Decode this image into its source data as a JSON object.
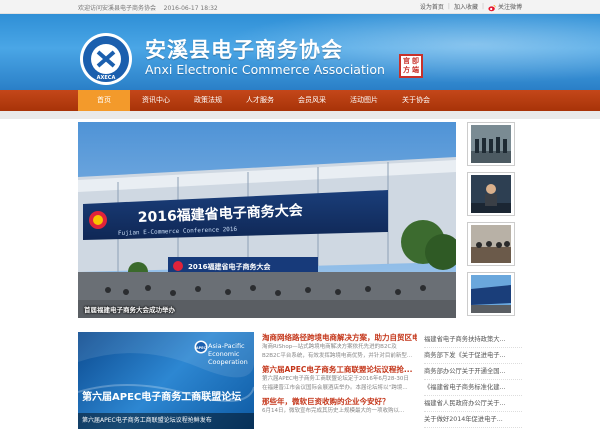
{
  "topbar": {
    "welcome": "欢迎访问安溪县电子商务协会",
    "date": "2016-06-17 18:32",
    "links": [
      "设为首页",
      "加入收藏",
      "关注微博"
    ]
  },
  "header": {
    "title_cn": "安溪县电子商务协会",
    "title_en": "Anxi Electronic Commerce Association",
    "logo_abbr": "AXECA",
    "seal_chars": [
      "卽",
      "官",
      "端",
      "方"
    ]
  },
  "nav": {
    "items": [
      "首页",
      "资讯中心",
      "政策法规",
      "人才服务",
      "会员风采",
      "活动图片",
      "关于协会"
    ],
    "active_index": 0
  },
  "slideshow": {
    "banner_text": "2016福建省电子商务大会",
    "banner_en": "Fujian E-Commerce Conference 2016",
    "caption": "首届福建电子商务大会成功举办"
  },
  "promo": {
    "apec_label": "APEC",
    "apec_text": [
      "Asia-Pacific",
      "Economic Cooperation"
    ],
    "headline": "第六届APEC电子商务工商联盟论坛",
    "caption": "第六届APEC电子商务工商联盟论坛议程抢鲜发布"
  },
  "news": [
    {
      "title": "淘商网络路径跨境电商解决方案，助力自贸区电...",
      "desc": [
        "淘商RiShop—站式跨境电商解决方案依托先进的B2C及",
        "B2B2C平台系统，有效发挥跨境电商优势，并针对目前新型..."
      ]
    },
    {
      "title": "第六届APEC电子商务工商联盟论坛议程抢...",
      "desc": [
        "第六届APEC电子商务工商联盟论坛定于2016年6月28-30日",
        "在福建晋江市会议国际会展酒店举办。本届论坛将以“跨境..."
      ]
    },
    {
      "title": "那些年，微软巨资收购的企业今安好？",
      "desc": [
        "6月14日，微软宣布完成其历史上规模最大的一项收购以..."
      ]
    }
  ],
  "right_list": [
    "福建省电子商务扶持政策大...",
    "商务部下发《关于促进电子...",
    "商务部办公厅关于开通全国...",
    "《福建省电子商务标准化建...",
    "福建省人民政府办公厅关于...",
    "关于做好2014年促进电子..."
  ]
}
